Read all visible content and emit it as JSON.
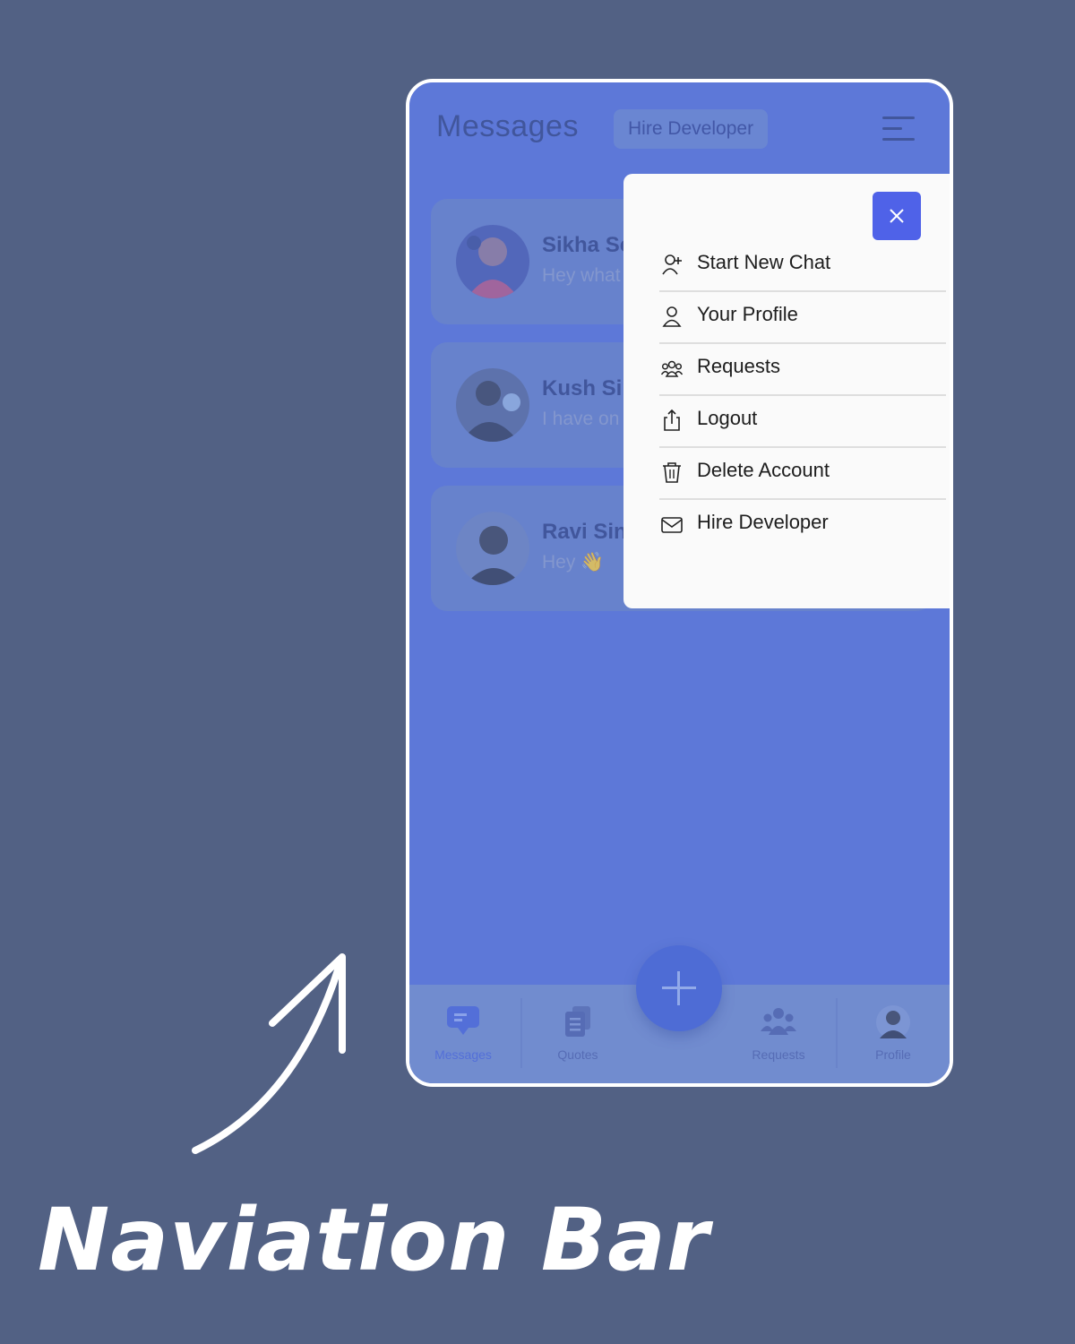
{
  "header": {
    "title": "Messages",
    "hire_chip": "Hire Developer",
    "menu_icon": "hamburger-menu-icon"
  },
  "chats": [
    {
      "name": "Sikha Sc",
      "message": "Hey what",
      "avatar": "avatar-photo"
    },
    {
      "name": "Kush Sir",
      "message": "I have on",
      "avatar": "avatar-photo"
    },
    {
      "name": "Ravi Sin",
      "message": "Hey 👋",
      "avatar": "avatar-photo"
    }
  ],
  "dropdown": {
    "close_icon": "close-icon",
    "items": [
      {
        "label": "Start New Chat",
        "icon": "user-plus-icon"
      },
      {
        "label": "Your Profile",
        "icon": "user-icon"
      },
      {
        "label": "Requests",
        "icon": "users-group-icon"
      },
      {
        "label": "Logout",
        "icon": "logout-icon"
      },
      {
        "label": "Delete Account",
        "icon": "trash-icon"
      },
      {
        "label": "Hire Developer",
        "icon": "mail-icon"
      }
    ]
  },
  "fab": {
    "icon": "plus-icon"
  },
  "navbar": {
    "items": [
      {
        "label": "Messages",
        "icon": "chat-bubble-icon",
        "active": true
      },
      {
        "label": "Quotes",
        "icon": "documents-icon",
        "active": false
      },
      {
        "label": "Requests",
        "icon": "people-icon",
        "active": false
      },
      {
        "label": "Profile",
        "icon": "profile-avatar-icon",
        "active": false
      }
    ]
  },
  "colors": {
    "background": "#526184",
    "accent": "#4f62e8",
    "fab": "#3451d1",
    "dropdown_bg": "#fafafa"
  },
  "caption": "Naviation Bar"
}
